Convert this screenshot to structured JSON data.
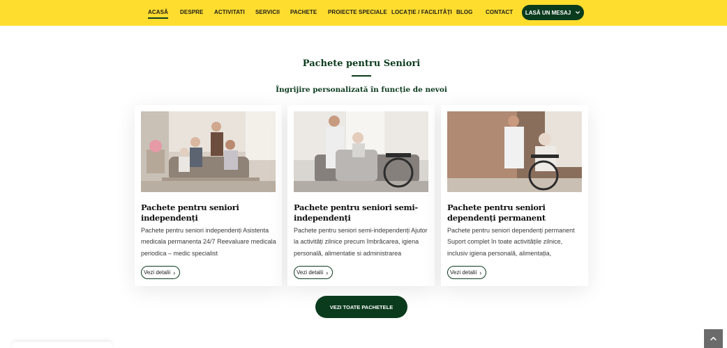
{
  "nav": {
    "items": [
      "ACASĂ",
      "DESPRE",
      "ACTIVITATI",
      "SERVICII",
      "PACHETE",
      "PROIECTE SPECIALE",
      "LOCAȚIE / FACILITĂȚI",
      "BLOG",
      "CONTACT"
    ],
    "active_index": 0,
    "cta_label": "LASĂ UN MESAJ",
    "cta_icon": "chevron-down-icon"
  },
  "section": {
    "title": "Pachete pentru Seniori",
    "subtitle": "Îngrijire personalizată în funcție de nevoi"
  },
  "cards": [
    {
      "title": "Pachete pentru seniori independenți",
      "description": "Pachete pentru seniori independenți Asistenta medicala permanenta 24/7 Reevaluare medicala periodica – medic specialist",
      "button_label": "Vezi detalii"
    },
    {
      "title": "Pachete pentru seniori semi-independenți",
      "description": "Pachete pentru seniori semi-independenți Ajutor la activități zilnice precum îmbrăcarea, igiena personală, alimentatie si administrarea",
      "button_label": "Vezi detalii"
    },
    {
      "title": "Pachete pentru seniori dependenți permanent",
      "description": "Pachete pentru seniori dependenți permanent Suport complet în toate activitățile zilnice, inclusiv igiena personală, alimentația,",
      "button_label": "Vezi detalii"
    }
  ],
  "all_packages_label": "VEZI TOATE PACHETELE",
  "colors": {
    "navbar_bg": "#ffdd2e",
    "brand_green": "#0b3b1d"
  }
}
